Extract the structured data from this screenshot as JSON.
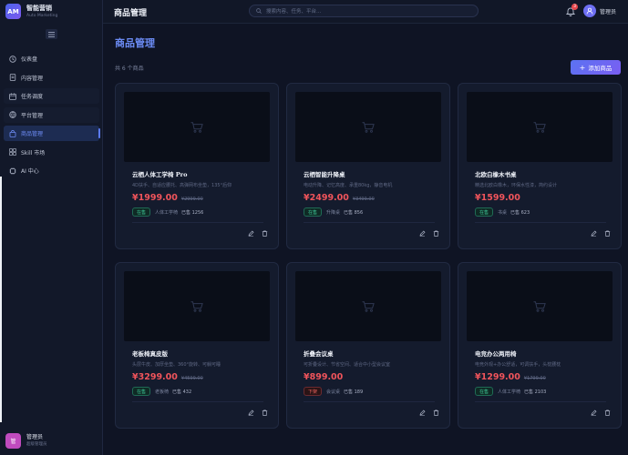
{
  "brand": {
    "logo": "AM",
    "name": "智能营销",
    "sub": "Auto Marketing"
  },
  "sidebar": {
    "items": [
      {
        "label": "仪表盘",
        "icon": "clock-icon"
      },
      {
        "label": "内容管理",
        "icon": "document-icon"
      },
      {
        "label": "任务调度",
        "icon": "calendar-icon"
      },
      {
        "label": "平台管理",
        "icon": "globe-icon"
      },
      {
        "label": "商品管理",
        "icon": "shopping-bag-icon"
      },
      {
        "label": "Skill 市场",
        "icon": "grid-icon"
      },
      {
        "label": "AI 中心",
        "icon": "chip-icon"
      }
    ]
  },
  "user": {
    "avatar": "管",
    "name": "管理员",
    "role": "超级管理员"
  },
  "header": {
    "title": "商品管理",
    "search_placeholder": "搜索内容、任务、平台...",
    "notification_count": "3",
    "user_name": "管理员"
  },
  "main": {
    "title": "商品管理",
    "count_text": "共 6 个商品",
    "add_button": "添加商品"
  },
  "products": [
    {
      "name": "云栖人体工学椅 Pro",
      "desc": "4D扶手、自适应腰托、高弹网布坐垫，135°后仰",
      "price": "¥1999.00",
      "orig": "¥2999.00",
      "status": "在售",
      "category": "人体工学椅",
      "sales": "已售 1256"
    },
    {
      "name": "云栖智能升降桌",
      "desc": "电动升降、记忆高度、承重80kg，静音电机",
      "price": "¥2499.00",
      "orig": "¥3499.00",
      "status": "在售",
      "category": "升降桌",
      "sales": "已售 856"
    },
    {
      "name": "北欧白橡木书桌",
      "desc": "精选北欧白橡木，环保水性漆，简约设计",
      "price": "¥1599.00",
      "orig": "",
      "status": "在售",
      "category": "书桌",
      "sales": "已售 623"
    },
    {
      "name": "老板椅真皮版",
      "desc": "头层牛皮、加厚坐垫、360°旋转、可躺可睡",
      "price": "¥3299.00",
      "orig": "¥4599.00",
      "status": "在售",
      "category": "老板椅",
      "sales": "已售 432"
    },
    {
      "name": "折叠会议桌",
      "desc": "可折叠设计、节省空间、适合中小型会议室",
      "price": "¥899.00",
      "orig": "",
      "status": "下架",
      "category": "会议桌",
      "sales": "已售 189"
    },
    {
      "name": "电竞办公两用椅",
      "desc": "电竞外观+办公舒适，可调扶手，头枕腰枕",
      "price": "¥1299.00",
      "orig": "¥1799.00",
      "status": "在售",
      "category": "人体工学椅",
      "sales": "已售 2103"
    }
  ],
  "colors": {
    "accent": "#5b7bf5",
    "price": "#f0545b",
    "on_sale": "#3fcf9c",
    "off_sale": "#f0645f"
  }
}
